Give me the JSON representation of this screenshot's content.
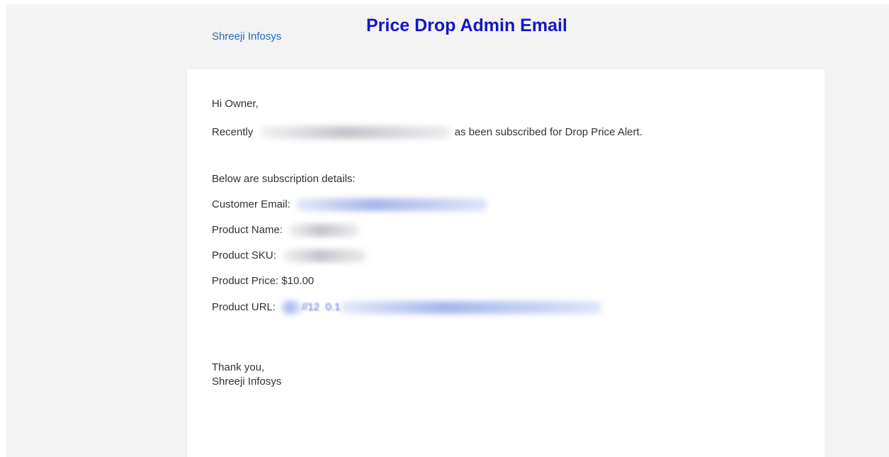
{
  "header": {
    "brand": "Shreeji Infosys",
    "title": "Price Drop Admin Email"
  },
  "email": {
    "greeting": "Hi Owner,",
    "intro_prefix": "Recently",
    "intro_suffix": "as been subscribed for Drop Price Alert.",
    "details_heading": "Below are subscription details:",
    "customer_email_label": "Customer Email:",
    "product_name_label": "Product Name:",
    "product_sku_label": "Product SKU:",
    "product_price_label": "Product Price:",
    "product_price_value": "$10.00",
    "product_url_label": "Product URL:",
    "product_url_visible": "//12  0.1",
    "closing": "Thank you,",
    "signature": "Shreeji Infosys"
  }
}
